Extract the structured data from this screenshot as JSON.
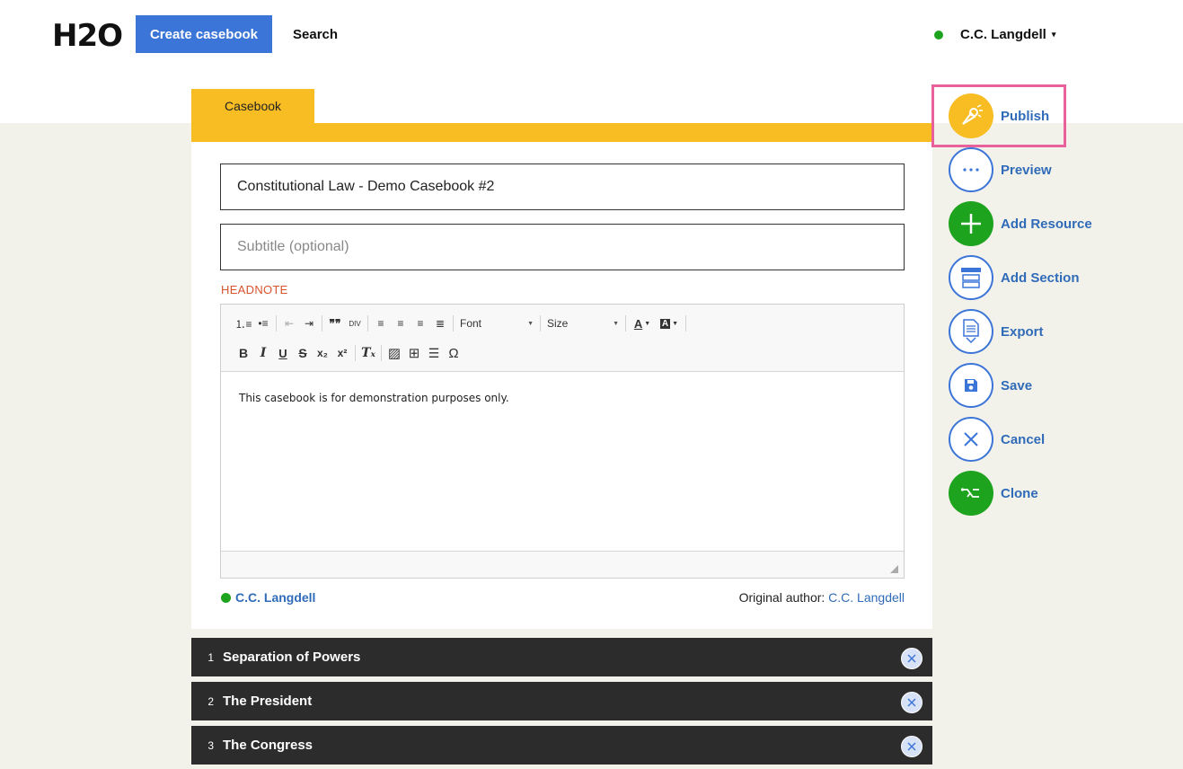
{
  "header": {
    "logo": "H2O",
    "create_label": "Create casebook",
    "search_label": "Search",
    "user_name": "C.C. Langdell",
    "user_caret": "▾",
    "status_color": "#1ea31e",
    "accent_color": "#3c75d8"
  },
  "tabs": [
    {
      "label": "Casebook"
    }
  ],
  "form": {
    "title_value": "Constitutional Law - Demo Casebook #2",
    "subtitle_placeholder": "Subtitle (optional)",
    "headnote_label": "HEADNOTE"
  },
  "editor": {
    "toolbar_row1": [
      {
        "name": "numbered-list-icon",
        "glyph": "⒈≡"
      },
      {
        "name": "bulleted-list-icon",
        "glyph": "•≡"
      },
      {
        "name": "outdent-icon",
        "glyph": "⇤"
      },
      {
        "name": "indent-icon",
        "glyph": "⇥"
      },
      {
        "name": "blockquote-icon",
        "glyph": "❞❞"
      },
      {
        "name": "div-container-icon",
        "glyph": "DIV"
      },
      {
        "name": "align-left-icon",
        "glyph": "≡"
      },
      {
        "name": "align-center-icon",
        "glyph": "≡"
      },
      {
        "name": "align-right-icon",
        "glyph": "≡"
      },
      {
        "name": "align-justify-icon",
        "glyph": "≣"
      }
    ],
    "font_label": "Font",
    "size_label": "Size",
    "text_color_glyph": "A",
    "bg_color_glyph": "A",
    "toolbar_row2": [
      {
        "name": "bold-icon",
        "glyph": "B"
      },
      {
        "name": "italic-icon",
        "glyph": "I"
      },
      {
        "name": "underline-icon",
        "glyph": "U"
      },
      {
        "name": "strikethrough-icon",
        "glyph": "S"
      },
      {
        "name": "subscript-icon",
        "glyph": "x₂"
      },
      {
        "name": "superscript-icon",
        "glyph": "x²"
      },
      {
        "name": "remove-format-icon",
        "glyph": "Tₓ"
      },
      {
        "name": "image-icon",
        "glyph": "▨"
      },
      {
        "name": "table-icon",
        "glyph": "⊞"
      },
      {
        "name": "horizontal-rule-icon",
        "glyph": "☰"
      },
      {
        "name": "special-char-icon",
        "glyph": "Ω"
      }
    ],
    "body_text": "This casebook is for demonstration purposes only."
  },
  "authors": {
    "current_author": "C.C. Langdell",
    "original_label": "Original author: ",
    "original_author": "C.C. Langdell"
  },
  "sections": [
    {
      "number": "1",
      "title": "Separation of Powers"
    },
    {
      "number": "2",
      "title": "The President"
    },
    {
      "number": "3",
      "title": "The Congress"
    }
  ],
  "actions": [
    {
      "label": "Publish",
      "icon": "publish-icon",
      "color": "#f8bd23"
    },
    {
      "label": "Preview",
      "icon": "preview-icon",
      "color": "#3c75d8"
    },
    {
      "label": "Add Resource",
      "icon": "add-resource-icon",
      "color": "#1ea31e"
    },
    {
      "label": "Add Section",
      "icon": "add-section-icon",
      "color": "#3c75d8"
    },
    {
      "label": "Export",
      "icon": "export-icon",
      "color": "#3c75d8"
    },
    {
      "label": "Save",
      "icon": "save-icon",
      "color": "#3c75d8"
    },
    {
      "label": "Cancel",
      "icon": "cancel-icon",
      "color": "#3c75d8"
    },
    {
      "label": "Clone",
      "icon": "clone-icon",
      "color": "#1ea31e"
    }
  ]
}
